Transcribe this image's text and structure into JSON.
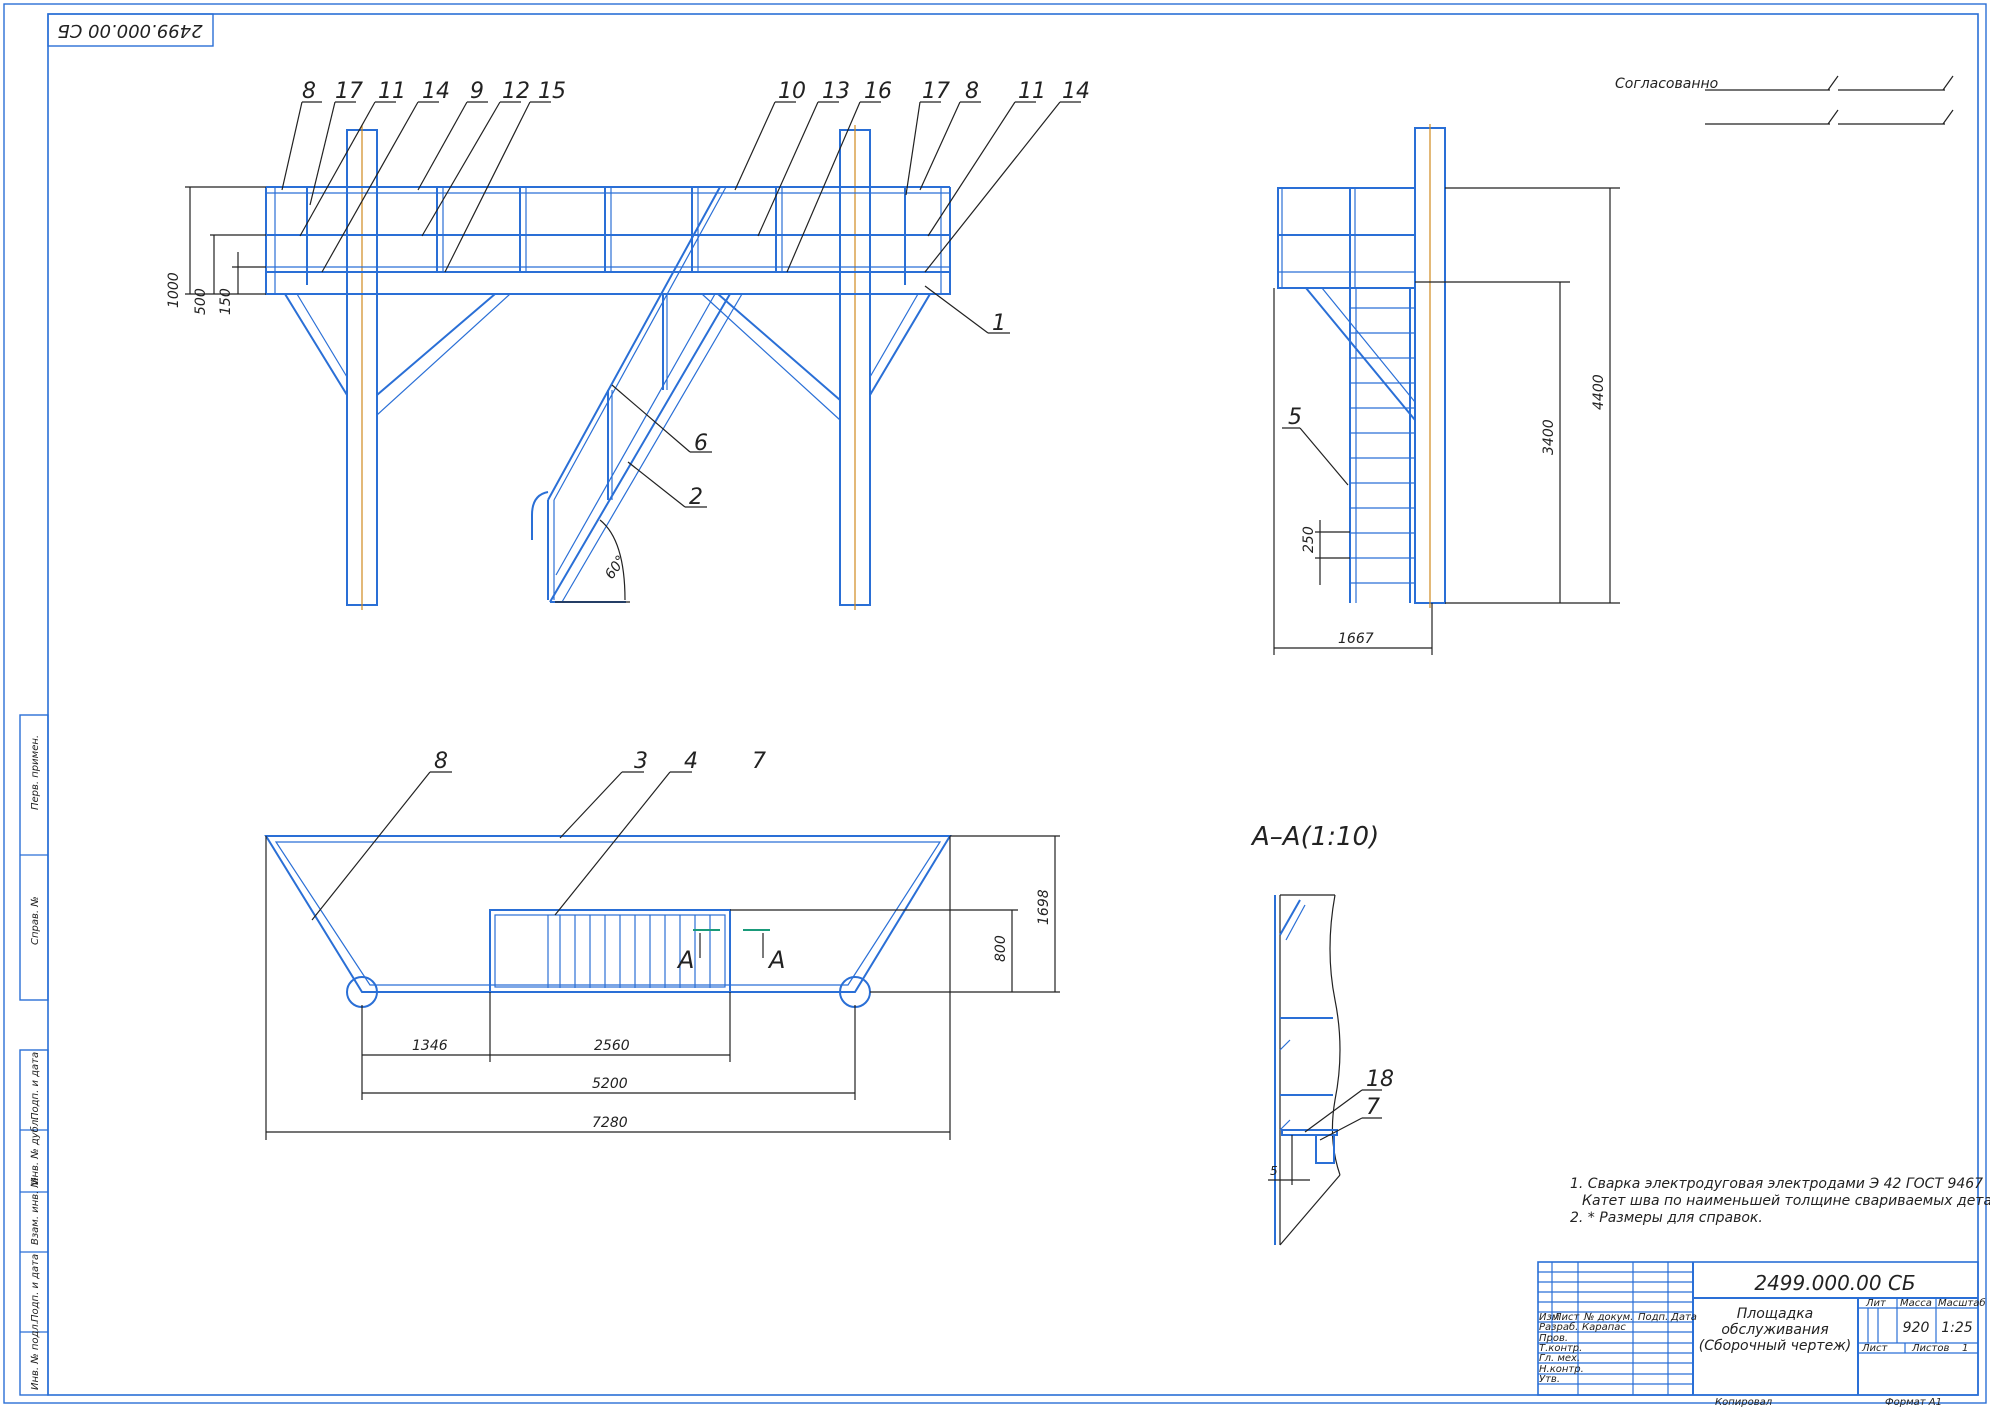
{
  "drawing_code_rotated": "2499.000.00 СБ",
  "approval": {
    "label": "Согласованно"
  },
  "front_view": {
    "callouts": [
      "8",
      "17",
      "11",
      "14",
      "9",
      "12",
      "15",
      "10",
      "13",
      "16",
      "17",
      "8",
      "11",
      "14",
      "1",
      "6",
      "2"
    ],
    "dims": {
      "d1000": "1000",
      "d500": "500",
      "d150": "150",
      "angle": "60°"
    }
  },
  "side_view": {
    "callout": "5",
    "dims": {
      "d4400": "4400",
      "d3400": "3400",
      "d250": "250",
      "d1667": "1667"
    }
  },
  "plan_view": {
    "callouts": [
      "8",
      "3",
      "4",
      "7"
    ],
    "section_mark": "А",
    "dims": {
      "d1698": "1698",
      "d800": "800",
      "d1346": "1346",
      "d2560": "2560",
      "d5200": "5200",
      "d7280": "7280"
    }
  },
  "section": {
    "title": "А–А(1:10)",
    "callouts": [
      "18",
      "7"
    ],
    "dim_small": "5"
  },
  "notes": [
    "1. Сварка электродуговая электродами Э 42 ГОСТ 9467",
    "Катет шва по наименьшей толщине свариваемых деталей",
    "2. * Размеры для справок."
  ],
  "title_block": {
    "code": "2499.000.00 СБ",
    "name_lines": [
      "Площадка",
      "обслуживания",
      "(Сборочный чертеж)"
    ],
    "headers": {
      "lit": "Лит",
      "mass": "Масса",
      "scale": "Масштаб"
    },
    "mass": "920",
    "scale": "1:25",
    "sheet_label": "Лист",
    "sheets_label": "Листов",
    "sheets_value": "1",
    "col_headers": [
      "Изм",
      "Лист",
      "№ докум.",
      "Подп.",
      "Дата"
    ],
    "rows": [
      "Разраб.",
      "Пров.",
      "Т.контр.",
      "Гл. мех.",
      "Н.контр.",
      "Утв."
    ],
    "developer": "Карапас",
    "copied": "Копировал",
    "format": "Формат   А1"
  },
  "side_strip": [
    "Перв. примен.",
    "Справ. №",
    "Подп. и дата",
    "Инв. № дубл.",
    "Взам. инв. №",
    "Подп. и дата",
    "Инв. № подл."
  ]
}
